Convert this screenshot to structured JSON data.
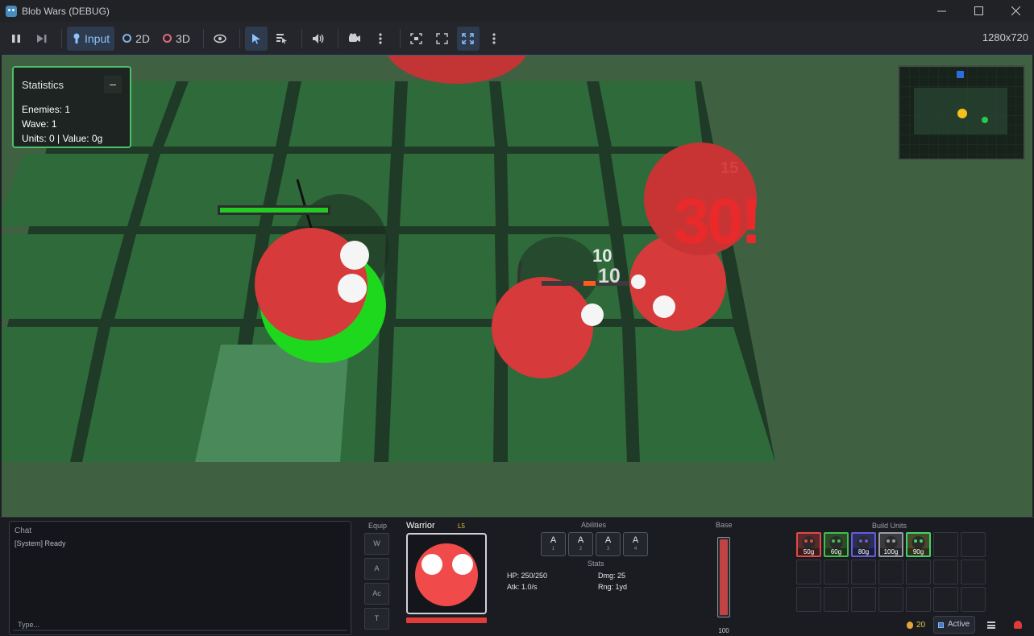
{
  "window": {
    "title": "Blob Wars (DEBUG)"
  },
  "toolbar": {
    "input_label": "Input",
    "mode_2d_label": "2D",
    "mode_3d_label": "3D",
    "resolution": "1280x720"
  },
  "stats": {
    "title": "Statistics",
    "minimize_label": "–",
    "enemies": "Enemies: 1",
    "wave": "Wave: 1",
    "units_value": "Units: 0 | Value: 0g"
  },
  "damage_numbers": {
    "big": "30!",
    "faded": "15",
    "first": "10",
    "second": "10"
  },
  "chat": {
    "title": "Chat",
    "message": "[System] Ready",
    "placeholder": "Type..."
  },
  "equip": {
    "label": "Equip",
    "slots": [
      "W",
      "A",
      "Ac",
      "T"
    ]
  },
  "unit": {
    "name": "Warrior",
    "level": "L5",
    "hp_fraction": 1.0
  },
  "abilities": {
    "label": "Abilities",
    "items": [
      {
        "key": "A",
        "num": "1"
      },
      {
        "key": "A",
        "num": "2"
      },
      {
        "key": "A",
        "num": "3"
      },
      {
        "key": "A",
        "num": "4"
      }
    ]
  },
  "stats_panel": {
    "label": "Stats",
    "hp": "HP: 250/250",
    "dmg": "Dmg: 25",
    "atk": "Atk: 1.0/s",
    "rng": "Rng: 1yd"
  },
  "base": {
    "label": "Base",
    "value": "100",
    "fraction": 1.0
  },
  "build": {
    "label": "Build Units",
    "units": [
      {
        "cost": "50g",
        "border": "#e04848",
        "bg": "#5a2a2a"
      },
      {
        "cost": "60g",
        "border": "#3fbf4f",
        "bg": "#2f4a2a"
      },
      {
        "cost": "80g",
        "border": "#6b5bd6",
        "bg": "#2a2f5a"
      },
      {
        "cost": "100g",
        "border": "#9a9ca3",
        "bg": "#3a3a40"
      },
      {
        "cost": "90g",
        "border": "#3fd66b",
        "bg": "#4a4a2a"
      }
    ]
  },
  "footer": {
    "gold": "20",
    "status": "Active"
  },
  "colors": {
    "accent": "#8cc4ff",
    "hp_green": "#22cc22",
    "enemy_red": "#d23a3a",
    "damage_red": "#e82a2a"
  }
}
